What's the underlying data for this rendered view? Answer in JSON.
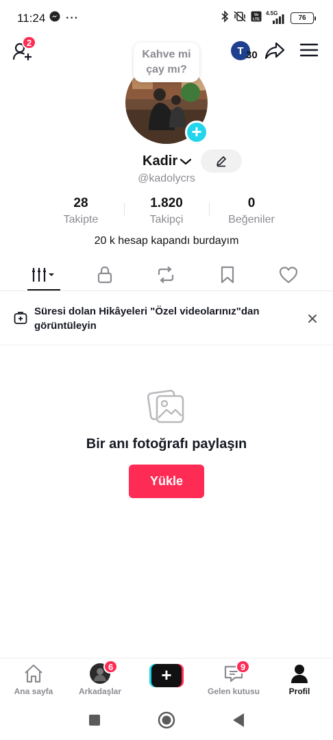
{
  "status_bar": {
    "time": "11:24",
    "network_label": "4.5G",
    "battery": "76",
    "more": "···"
  },
  "header": {
    "friend_requests_badge": "2",
    "coin_letter": "T",
    "coin_count": "30"
  },
  "profile": {
    "bubble_text_line1": "Kahve mi",
    "bubble_text_line2": "çay mı?",
    "name": "Kadir",
    "handle": "@kadolycrs",
    "stats": [
      {
        "value": "28",
        "label": "Takipte"
      },
      {
        "value": "1.820",
        "label": "Takipçi"
      },
      {
        "value": "0",
        "label": "Beğeniler"
      }
    ],
    "bio": "20 k hesap kapandı burdayım"
  },
  "tabs": [
    "grid-icon",
    "lock-icon",
    "repost-icon",
    "bookmark-icon",
    "heart-icon"
  ],
  "notice": {
    "text": "Süresi dolan Hikâyeleri \"Özel videolarınız\"dan görüntüleyin"
  },
  "empty_state": {
    "title": "Bir anı fotoğrafı paylaşın",
    "button": "Yükle"
  },
  "bottom_nav": {
    "items": [
      {
        "label": "Ana sayfa",
        "icon": "home-icon"
      },
      {
        "label": "Arkadaşlar",
        "icon": "friends-avatar",
        "badge": "6"
      },
      {
        "label": "",
        "icon": "create-icon"
      },
      {
        "label": "Gelen kutusu",
        "icon": "inbox-icon",
        "badge": "9"
      },
      {
        "label": "Profil",
        "icon": "profile-icon",
        "active": true
      }
    ]
  },
  "colors": {
    "accent": "#fe2c55",
    "cyan": "#20d5ec",
    "text": "#161823",
    "muted": "#8a8b91"
  }
}
